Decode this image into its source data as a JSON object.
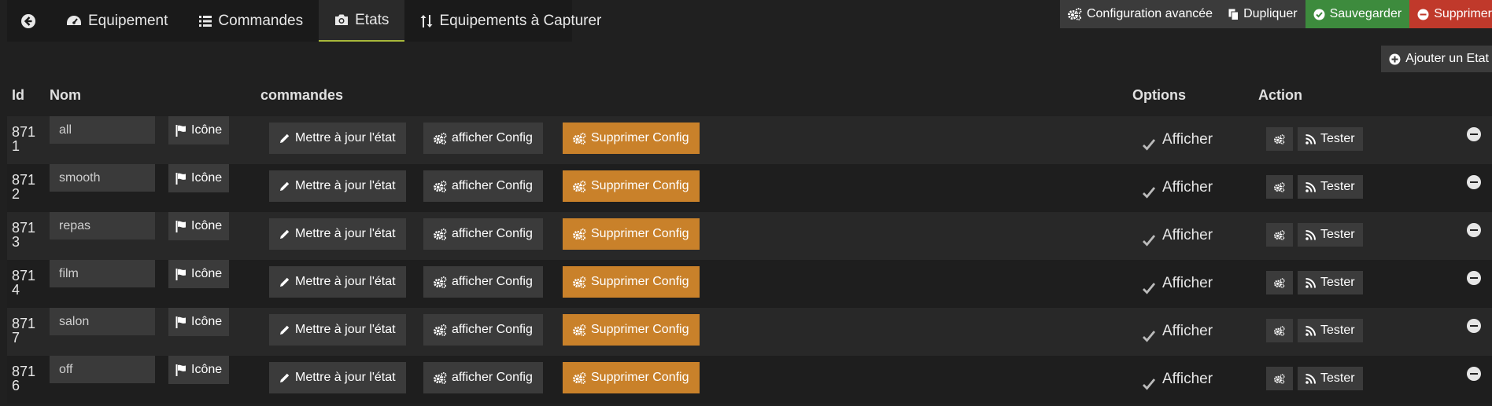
{
  "tabs": {
    "back_icon": "arrow-circle-left-icon",
    "items": [
      {
        "label": "Equipement",
        "icon": "tachometer-icon"
      },
      {
        "label": "Commandes",
        "icon": "list-icon"
      },
      {
        "label": "Etats",
        "icon": "camera-icon",
        "active": true
      },
      {
        "label": "Equipements à Capturer",
        "icon": "sort-arrows-icon"
      }
    ]
  },
  "actions": {
    "config": "Configuration avancée",
    "dupliquer": "Dupliquer",
    "sauvegarder": "Sauvegarder",
    "supprimer": "Supprimer",
    "ajouter": "Ajouter un Etat"
  },
  "colors": {
    "accent_active_tab": "#a8b83a",
    "save_green": "#3d8b3d",
    "delete_red": "#c0392b",
    "config_orange": "#c9812a"
  },
  "table": {
    "headers": {
      "id": "Id",
      "nom": "Nom",
      "commandes": "commandes",
      "options": "Options",
      "action": "Action"
    },
    "labels": {
      "icone": "Icône",
      "mettre_a_jour": "Mettre à jour l'état",
      "afficher_config": "afficher Config",
      "supprimer_config": "Supprimer Config",
      "afficher": "Afficher",
      "tester": "Tester"
    },
    "rows": [
      {
        "id": "8711",
        "name": "all",
        "afficher": true
      },
      {
        "id": "8712",
        "name": "smooth",
        "afficher": true
      },
      {
        "id": "8713",
        "name": "repas",
        "afficher": true
      },
      {
        "id": "8714",
        "name": "film",
        "afficher": true
      },
      {
        "id": "8717",
        "name": "salon",
        "afficher": true
      },
      {
        "id": "8716",
        "name": "off",
        "afficher": true
      }
    ]
  }
}
